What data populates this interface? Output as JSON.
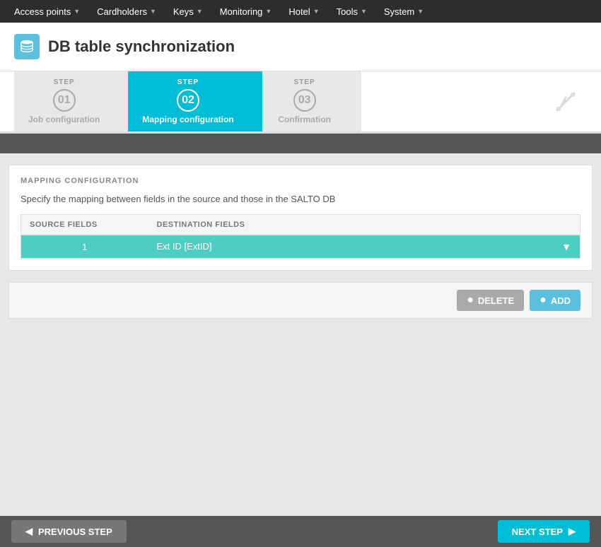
{
  "nav": {
    "items": [
      {
        "label": "Access points",
        "id": "access-points"
      },
      {
        "label": "Cardholders",
        "id": "cardholders"
      },
      {
        "label": "Keys",
        "id": "keys"
      },
      {
        "label": "Monitoring",
        "id": "monitoring"
      },
      {
        "label": "Hotel",
        "id": "hotel"
      },
      {
        "label": "Tools",
        "id": "tools"
      },
      {
        "label": "System",
        "id": "system"
      }
    ]
  },
  "page": {
    "title": "DB table synchronization",
    "icon": "🗄"
  },
  "steps": [
    {
      "id": "step-01",
      "number": "01",
      "name": "Job configuration",
      "state": "inactive"
    },
    {
      "id": "step-02",
      "number": "02",
      "name": "Mapping configuration",
      "state": "active"
    },
    {
      "id": "step-03",
      "number": "03",
      "name": "Confirmation",
      "state": "inactive"
    }
  ],
  "mapping": {
    "section_title": "MAPPING CONFIGURATION",
    "description": "Specify the mapping between fields in the source and those in the SALTO DB",
    "table": {
      "columns": [
        {
          "id": "source-fields",
          "label": "SOURCE FIELDS"
        },
        {
          "id": "destination-fields",
          "label": "DESTINATION FIELDS"
        }
      ],
      "rows": [
        {
          "id": 1,
          "source": "1",
          "destination": "Ext ID [ExtID]",
          "selected": true
        }
      ]
    }
  },
  "actions": {
    "delete_label": "DELETE",
    "add_label": "ADD"
  },
  "bottom_nav": {
    "prev_label": "PREVIOUS STEP",
    "next_label": "NEXT STEP"
  }
}
